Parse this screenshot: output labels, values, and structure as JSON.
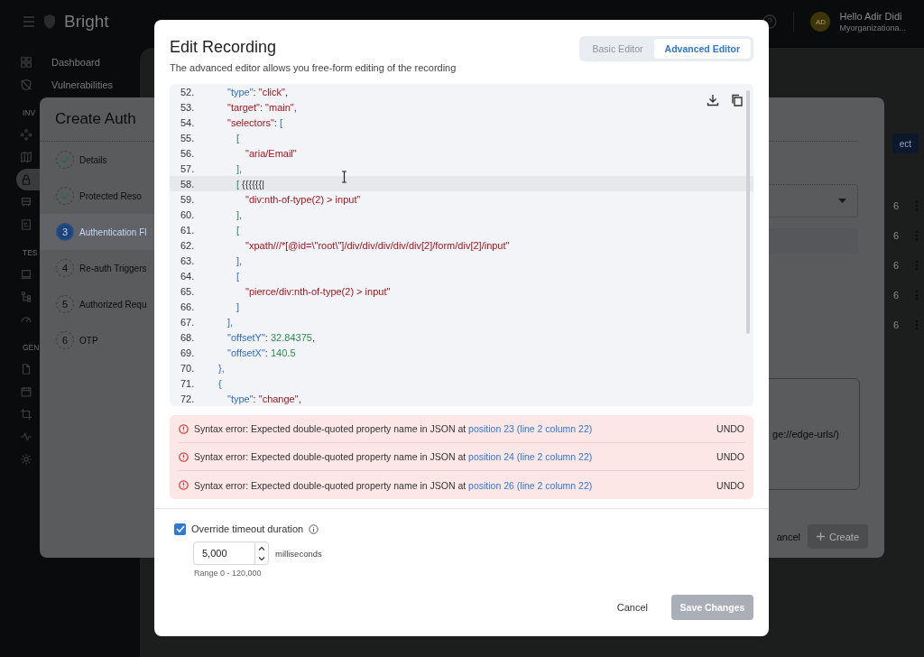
{
  "header": {
    "brand": "Bright",
    "avatar": "AD",
    "greeting": "Hello Adir Didi",
    "organization": "Myorganizationa..."
  },
  "sidebar": {
    "items": [
      {
        "label": "Dashboard",
        "selected": false
      },
      {
        "label": "Vulnerabilities",
        "selected": false
      }
    ],
    "sections": [
      {
        "heading": "INV",
        "items": [
          {
            "selected": false
          },
          {
            "selected": false
          },
          {
            "selected": true
          },
          {
            "selected": false
          },
          {
            "selected": false
          }
        ]
      },
      {
        "heading": "TES",
        "items": [
          {
            "selected": false
          },
          {
            "selected": false
          },
          {
            "selected": false
          }
        ]
      },
      {
        "heading": "GEN",
        "items": [
          {
            "selected": false
          },
          {
            "selected": false
          },
          {
            "selected": false
          },
          {
            "selected": false
          },
          {
            "selected": false
          }
        ]
      }
    ]
  },
  "page_right": {
    "button": "ect",
    "rows": [
      {
        "value": "6"
      },
      {
        "value": "6"
      },
      {
        "value": "6"
      },
      {
        "value": "6"
      },
      {
        "value": "6"
      }
    ]
  },
  "background_dialog": {
    "title": "Create Auth",
    "steps": [
      {
        "label": "Details",
        "completed": true,
        "selected": false
      },
      {
        "label": "Protected Reso",
        "completed": true,
        "selected": false
      },
      {
        "number": "3",
        "label": "Authentication Fl",
        "completed": false,
        "selected": true
      },
      {
        "number": "4",
        "label": "Re-auth Triggers",
        "completed": false,
        "selected": false
      },
      {
        "number": "5",
        "label": "Authorized Requ",
        "completed": false,
        "selected": false
      },
      {
        "number": "6",
        "label": "OTP",
        "completed": false,
        "selected": false
      }
    ],
    "url_text": "ge://edge-urls/)",
    "cancel": "ancel",
    "create": "Create"
  },
  "modal": {
    "title": "Edit Recording",
    "subtitle": "The advanced editor allows you free-form editing of the recording",
    "tabs": [
      {
        "label": "Basic Editor",
        "selected": false
      },
      {
        "label": "Advanced Editor",
        "selected": true
      }
    ],
    "code_lines": [
      {
        "number": "52.",
        "highlighted": false,
        "tokens": [
          {
            "kind": "key",
            "text": "      \"type\""
          },
          {
            "kind": "plain",
            "text": ": "
          },
          {
            "kind": "string",
            "text": "\"click\""
          },
          {
            "kind": "plain",
            "text": ","
          }
        ]
      },
      {
        "number": "53.",
        "highlighted": false,
        "tokens": [
          {
            "kind": "string",
            "text": "      \"target\""
          },
          {
            "kind": "plain",
            "text": ": "
          },
          {
            "kind": "string",
            "text": "\"main\""
          },
          {
            "kind": "plain",
            "text": ","
          }
        ]
      },
      {
        "number": "54.",
        "highlighted": false,
        "tokens": [
          {
            "kind": "string",
            "text": "      \"selectors\""
          },
          {
            "kind": "plain",
            "text": ": "
          },
          {
            "kind": "bracket-blue",
            "text": "["
          }
        ]
      },
      {
        "number": "55.",
        "highlighted": false,
        "tokens": [
          {
            "kind": "bracket-green",
            "text": "        ["
          }
        ]
      },
      {
        "number": "56.",
        "highlighted": false,
        "tokens": [
          {
            "kind": "string",
            "text": "          \"aria/Email\""
          }
        ]
      },
      {
        "number": "57.",
        "highlighted": false,
        "tokens": [
          {
            "kind": "bracket-green",
            "text": "        ],"
          }
        ]
      },
      {
        "number": "58.",
        "highlighted": true,
        "tokens": [
          {
            "kind": "bracket-green",
            "text": "        ["
          },
          {
            "kind": "plain",
            "text": " {{{{{{|"
          }
        ]
      },
      {
        "number": "59.",
        "highlighted": false,
        "tokens": [
          {
            "kind": "string",
            "text": "          \"div:nth-of-type(2) > input”"
          }
        ]
      },
      {
        "number": "60.",
        "highlighted": false,
        "tokens": [
          {
            "kind": "bracket-green",
            "text": "        ],"
          }
        ]
      },
      {
        "number": "61.",
        "highlighted": false,
        "tokens": [
          {
            "kind": "bracket-green",
            "text": "        ["
          }
        ]
      },
      {
        "number": "62.",
        "highlighted": false,
        "tokens": [
          {
            "kind": "string",
            "text": "          \"xpath///*[@id=\\\"root\\\"]/div/div/div/div/div[2]/form/div[2]/input\""
          }
        ]
      },
      {
        "number": "63.",
        "highlighted": false,
        "tokens": [
          {
            "kind": "bracket-blue",
            "text": "        ],"
          }
        ]
      },
      {
        "number": "64.",
        "highlighted": false,
        "tokens": [
          {
            "kind": "bracket-blue",
            "text": "        ["
          }
        ]
      },
      {
        "number": "65.",
        "highlighted": false,
        "tokens": [
          {
            "kind": "string",
            "text": "          \"pierce/div:nth-of-type(2) > input\""
          }
        ]
      },
      {
        "number": "66.",
        "highlighted": false,
        "tokens": [
          {
            "kind": "bracket-blue",
            "text": "        ]"
          }
        ]
      },
      {
        "number": "67.",
        "highlighted": false,
        "tokens": [
          {
            "kind": "bracket-blue",
            "text": "      ],"
          }
        ]
      },
      {
        "number": "68.",
        "highlighted": false,
        "tokens": [
          {
            "kind": "key",
            "text": "      \"offsetY\""
          },
          {
            "kind": "plain",
            "text": ": "
          },
          {
            "kind": "number",
            "text": "32.84375"
          },
          {
            "kind": "plain",
            "text": ","
          }
        ]
      },
      {
        "number": "69.",
        "highlighted": false,
        "tokens": [
          {
            "kind": "key",
            "text": "      \"offsetX\""
          },
          {
            "kind": "plain",
            "text": ": "
          },
          {
            "kind": "number",
            "text": "140.5"
          }
        ]
      },
      {
        "number": "70.",
        "highlighted": false,
        "tokens": [
          {
            "kind": "bracket-blue",
            "text": "    },"
          }
        ]
      },
      {
        "number": "71.",
        "highlighted": false,
        "tokens": [
          {
            "kind": "bracket-blue",
            "text": "    {"
          }
        ]
      },
      {
        "number": "72.",
        "highlighted": false,
        "tokens": [
          {
            "kind": "key",
            "text": "      \"type\""
          },
          {
            "kind": "plain",
            "text": ": "
          },
          {
            "kind": "string",
            "text": "\"change\""
          },
          {
            "kind": "plain",
            "text": ","
          }
        ]
      }
    ],
    "errors": [
      {
        "message": "Syntax error: Expected double-quoted property name in JSON at ",
        "link": "position 23 (line 2 column 22)",
        "action": "UNDO"
      },
      {
        "message": "Syntax error: Expected double-quoted property name in JSON at ",
        "link": "position 24 (line 2 column 22)",
        "action": "UNDO"
      },
      {
        "message": "Syntax error: Expected double-quoted property name in JSON at ",
        "link": "position 26 (line 2 column 22)",
        "action": "UNDO"
      }
    ],
    "timeout": {
      "label": "Override timeout duration",
      "checked": true,
      "value": "5,000",
      "unit": "milliseconds",
      "range": "Range 0 - 120,000"
    },
    "buttons": {
      "cancel": "Cancel",
      "save": {
        "label": "Save Changes",
        "disabled": true
      }
    }
  }
}
